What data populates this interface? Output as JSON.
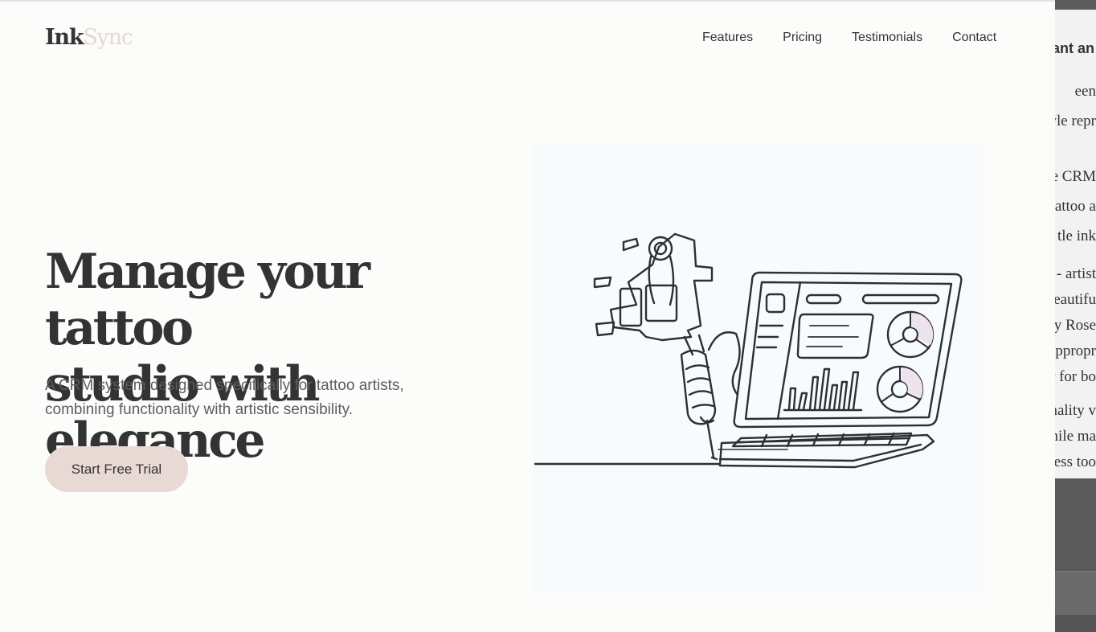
{
  "brand": {
    "part1": "Ink",
    "part2": "Sync"
  },
  "nav": {
    "items": [
      {
        "label": "Features"
      },
      {
        "label": "Pricing"
      },
      {
        "label": "Testimonials"
      },
      {
        "label": "Contact"
      }
    ]
  },
  "hero": {
    "title_line1": "Manage your tattoo",
    "title_line2": "studio with elegance",
    "subtitle_line1": "A CRM system designed specifically for tattoo artists,",
    "subtitle_line2": "combining functionality with artistic sensibility.",
    "cta_label": "Start Free Trial",
    "illustration_icon": "tattoo-machine-laptop-illustration"
  },
  "side_panel": {
    "heading": "ant an",
    "lines": [
      "een",
      "yle repr",
      "ne CRM",
      "attoo a",
      "tle ink",
      " - artist",
      "beautifu",
      "y Rose",
      "appropr",
      "r for bo",
      "nality v",
      "hile ma",
      "less too"
    ]
  },
  "colors": {
    "accent": "#e9d9d4",
    "logo_accent": "#e8d8d3",
    "text": "#333333",
    "background": "#fcfcfa"
  }
}
